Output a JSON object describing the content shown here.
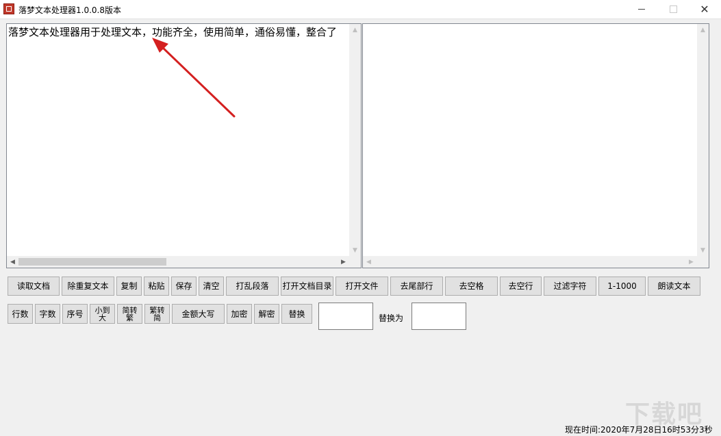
{
  "window": {
    "title": "落梦文本处理器1.0.0.8版本",
    "controls": {
      "minimize": "minimize-icon",
      "maximize": "maximize-icon",
      "close": "close-icon"
    }
  },
  "editor": {
    "left_text": "落梦文本处理器用于处理文本，功能齐全，使用简单，通俗易懂，整合了",
    "right_text": ""
  },
  "toolbar_row1": [
    "读取文档",
    "除重复文本",
    "复制",
    "粘贴",
    "保存",
    "清空",
    "打乱段落",
    "打开文档目录",
    "打开文件",
    "去尾部行",
    "去空格",
    "去空行",
    "过滤字符",
    "1-1000",
    "朗读文本"
  ],
  "toolbar_row2": [
    "行数",
    "字数",
    "序号",
    "小到大",
    "简转繁",
    "繁转简",
    "金额大写",
    "加密",
    "解密",
    "替换"
  ],
  "replace": {
    "label": "替换为",
    "find_value": "",
    "replace_value": ""
  },
  "status": {
    "time_label": "现在时间:",
    "time_value": "2020年7月28日16时53分3秒"
  },
  "watermark": "下载吧"
}
